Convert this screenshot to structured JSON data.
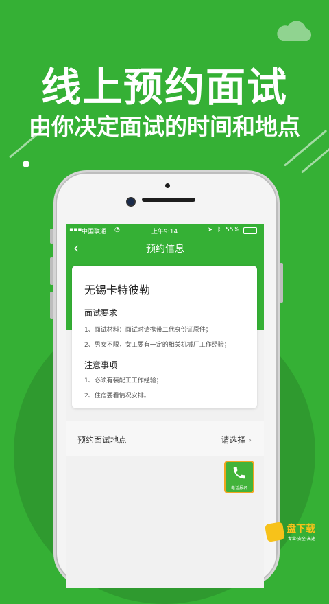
{
  "headline": {
    "title": "线上预约面试",
    "subtitle": "由你决定面试的时间和地点"
  },
  "status_bar": {
    "carrier": "中国联通",
    "time": "上午9:14",
    "battery": "55%"
  },
  "nav": {
    "title": "预约信息"
  },
  "card": {
    "company": "无锡卡特彼勒",
    "requirements_title": "面试要求",
    "requirements": [
      "1、面试材料：面试时请携带二代身份证原件；",
      "2、男女不限，女工要有一定的相关机械厂工作经验；"
    ],
    "notes_title": "注意事项",
    "notes": [
      "1、必须有装配工工作经验；",
      "2、住宿要看情况安排。"
    ]
  },
  "location": {
    "label": "预约面试地点",
    "value": "请选择"
  },
  "call_button": {
    "label": "电话报名",
    "icon": "phone-icon"
  },
  "brand": {
    "name": "盘下载",
    "slogan": "专业·安全·高速"
  },
  "colors": {
    "primary_green": "#35b035",
    "accent_orange": "#f2a51f",
    "brand_yellow": "#f7c21a"
  }
}
